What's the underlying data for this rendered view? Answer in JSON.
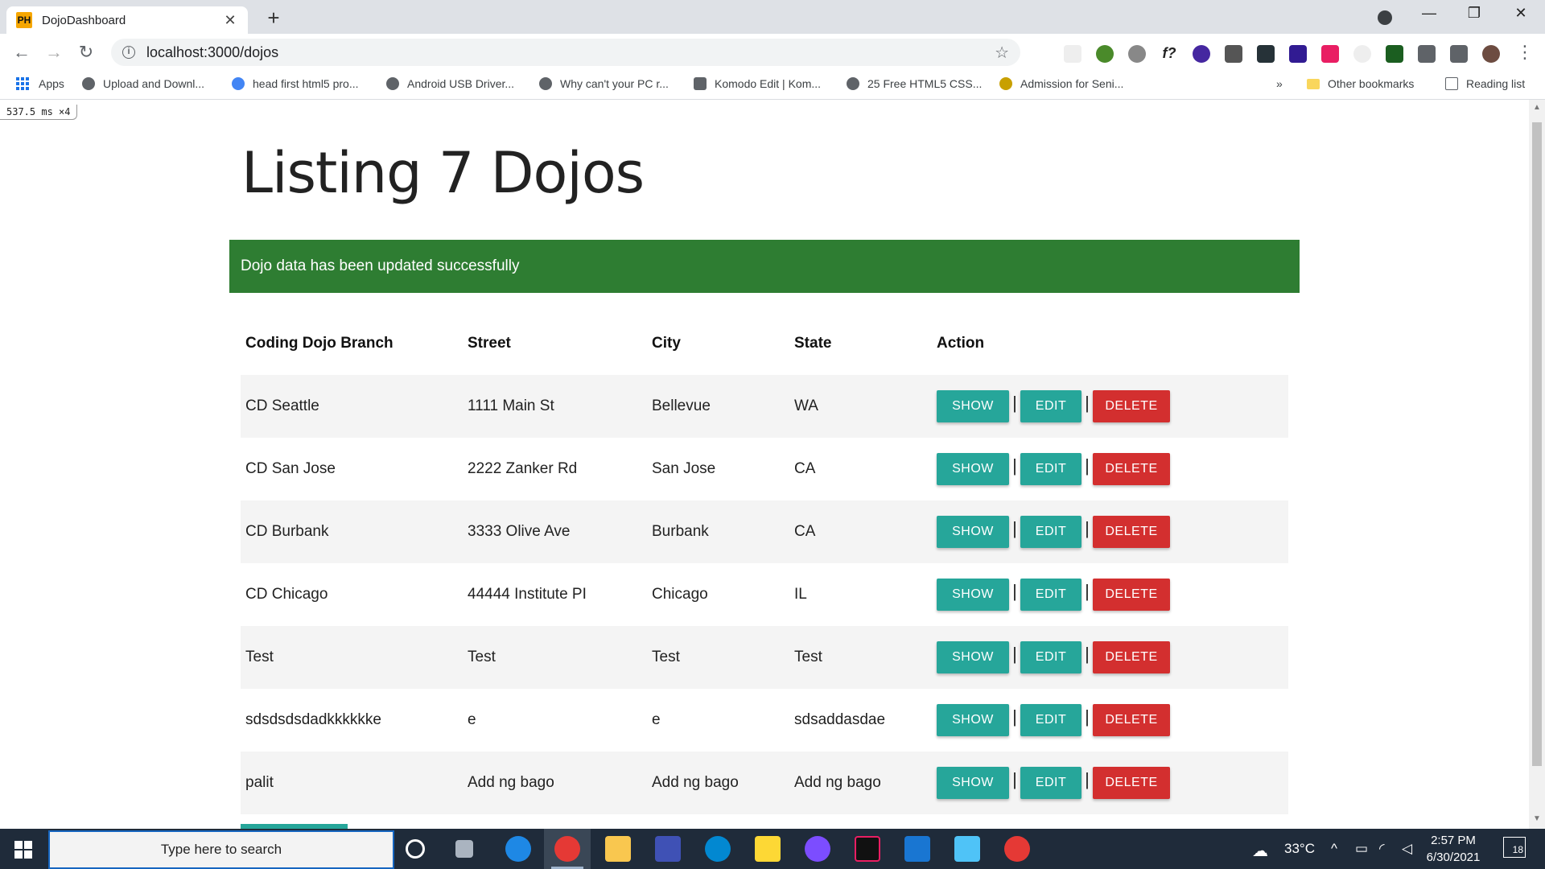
{
  "browser": {
    "tab_title": "DojoDashboard",
    "tab_favicon": "PH",
    "url": "localhost:3000/dojos",
    "bookmarks": [
      {
        "label": "Apps"
      },
      {
        "label": "Upload and Downl..."
      },
      {
        "label": "head first html5 pro..."
      },
      {
        "label": "Android USB Driver..."
      },
      {
        "label": "Why can't your PC r..."
      },
      {
        "label": "Komodo Edit | Kom..."
      },
      {
        "label": "25 Free HTML5 CSS..."
      },
      {
        "label": "Admission for Seni..."
      }
    ],
    "overflow": "»",
    "other_bookmarks": "Other bookmarks",
    "reading_list": "Reading list"
  },
  "perf_overlay": "537.5 ms ×4",
  "page": {
    "title": "Listing 7 Dojos",
    "flash": "Dojo data has been updated successfully",
    "columns": [
      "Coding Dojo Branch",
      "Street",
      "City",
      "State",
      "Action"
    ],
    "rows": [
      {
        "branch": "CD Seattle",
        "street": "1111 Main St",
        "city": "Bellevue",
        "state": "WA"
      },
      {
        "branch": "CD San Jose",
        "street": "2222 Zanker Rd",
        "city": "San Jose",
        "state": "CA"
      },
      {
        "branch": "CD Burbank",
        "street": "3333 Olive Ave",
        "city": "Burbank",
        "state": "CA"
      },
      {
        "branch": "CD Chicago",
        "street": "44444 Institute PI",
        "city": "Chicago",
        "state": "IL"
      },
      {
        "branch": "Test",
        "street": "Test",
        "city": "Test",
        "state": "Test"
      },
      {
        "branch": "sdsdsdsdadkkkkkke",
        "street": "e",
        "city": "e",
        "state": "sdsaddasdae"
      },
      {
        "branch": "palit",
        "street": "Add ng bago",
        "city": "Add ng bago",
        "state": "Add ng bago"
      }
    ],
    "actions": {
      "show": "SHOW",
      "edit": "EDIT",
      "delete": "DELETE",
      "separator": "|"
    },
    "colors": {
      "flash": "#2e7d32",
      "teal": "#26a69a",
      "red": "#d32f2f"
    }
  },
  "taskbar": {
    "search_placeholder": "Type here to search",
    "weather": "33°C",
    "time": "2:57 PM",
    "date": "6/30/2021",
    "notification_count": "18"
  }
}
